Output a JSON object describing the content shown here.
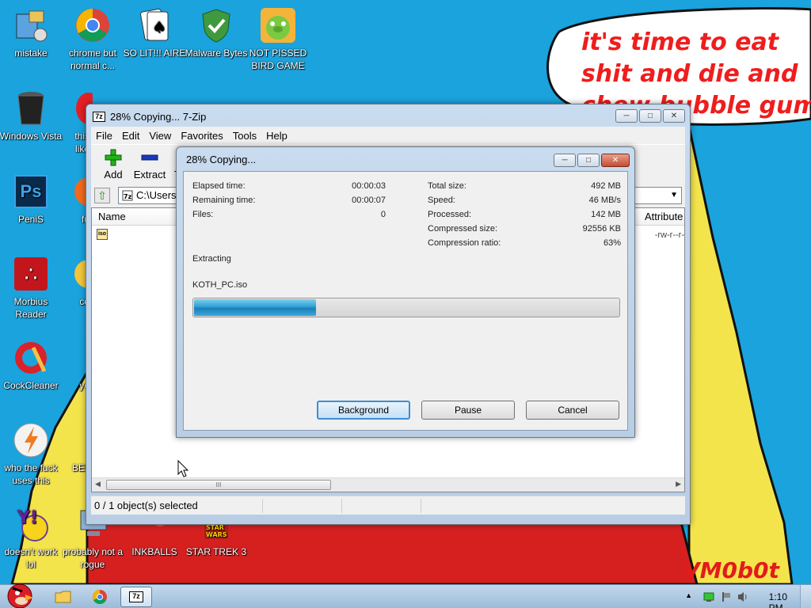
{
  "desktop": {
    "icons": [
      {
        "label": "mistake",
        "icon": "tools-icon"
      },
      {
        "label": "chrome but normal c...",
        "icon": "chrome-icon"
      },
      {
        "label": "SO LIT!!! AIRE",
        "icon": "solitaire-icon"
      },
      {
        "label": "Malware Bytes",
        "icon": "shield-icon"
      },
      {
        "label": "NOT PISSED BIRD GAME",
        "icon": "pig-icon"
      },
      {
        "label": "Windows Vista",
        "icon": "trash-icon"
      },
      {
        "label": "this like",
        "icon": "opera-icon"
      },
      {
        "label": "PeniS",
        "icon": "photoshop-icon"
      },
      {
        "label": "fu",
        "icon": "firefox-icon"
      },
      {
        "label": "Morbius Reader",
        "icon": "acrobat-icon"
      },
      {
        "label": "cd",
        "icon": "cd-icon"
      },
      {
        "label": "CockCleaner",
        "icon": "ccleaner-icon"
      },
      {
        "label": "yo",
        "icon": "star-icon"
      },
      {
        "label": "who the fuck uses this",
        "icon": "avast-icon"
      },
      {
        "label": "BEE",
        "icon": "bee-icon"
      },
      {
        "label": "doesn't work lol",
        "icon": "yahoo-icon"
      },
      {
        "label": "probably not a rogue",
        "icon": "computer-icon"
      },
      {
        "label": "INKBALLS",
        "icon": "inkball-icon"
      },
      {
        "label": "STAR TREK 3",
        "icon": "star-wars-icon"
      }
    ],
    "speech_bubble": "it's time to eat shit and die and chew bubble gum",
    "signature": "VM0b0t"
  },
  "main_window": {
    "title": "28% Copying... 7-Zip",
    "app_icon": "7z",
    "menu": [
      "File",
      "Edit",
      "View",
      "Favorites",
      "Tools",
      "Help"
    ],
    "toolbar": {
      "add": "Add",
      "extract": "Extract",
      "test": "T"
    },
    "path": "C:\\Users\\",
    "columns": {
      "name": "Name",
      "attributes": "Attribute"
    },
    "row": {
      "icon_text": "iso",
      "attributes": "-rw-r--r-"
    },
    "scroll_thumb_grip": "III",
    "status": "0 / 1 object(s) selected"
  },
  "dialog": {
    "title": "28% Copying...",
    "left": [
      {
        "key": "Elapsed time:",
        "value": "00:00:03"
      },
      {
        "key": "Remaining time:",
        "value": "00:00:07"
      },
      {
        "key": "Files:",
        "value": "0"
      }
    ],
    "right": [
      {
        "key": "Total size:",
        "value": "492 MB"
      },
      {
        "key": "Speed:",
        "value": "46 MB/s"
      },
      {
        "key": "Processed:",
        "value": "142 MB"
      },
      {
        "key": "Compressed size:",
        "value": "92556 KB"
      },
      {
        "key": "Compression ratio:",
        "value": "63%"
      }
    ],
    "operation": "Extracting",
    "filename": "KOTH_PC.iso",
    "progress_fraction": 0.29,
    "buttons": {
      "background": "Background",
      "pause": "Pause",
      "cancel": "Cancel"
    }
  },
  "taskbar": {
    "active_app": "7z",
    "time": "1:10 PM"
  }
}
